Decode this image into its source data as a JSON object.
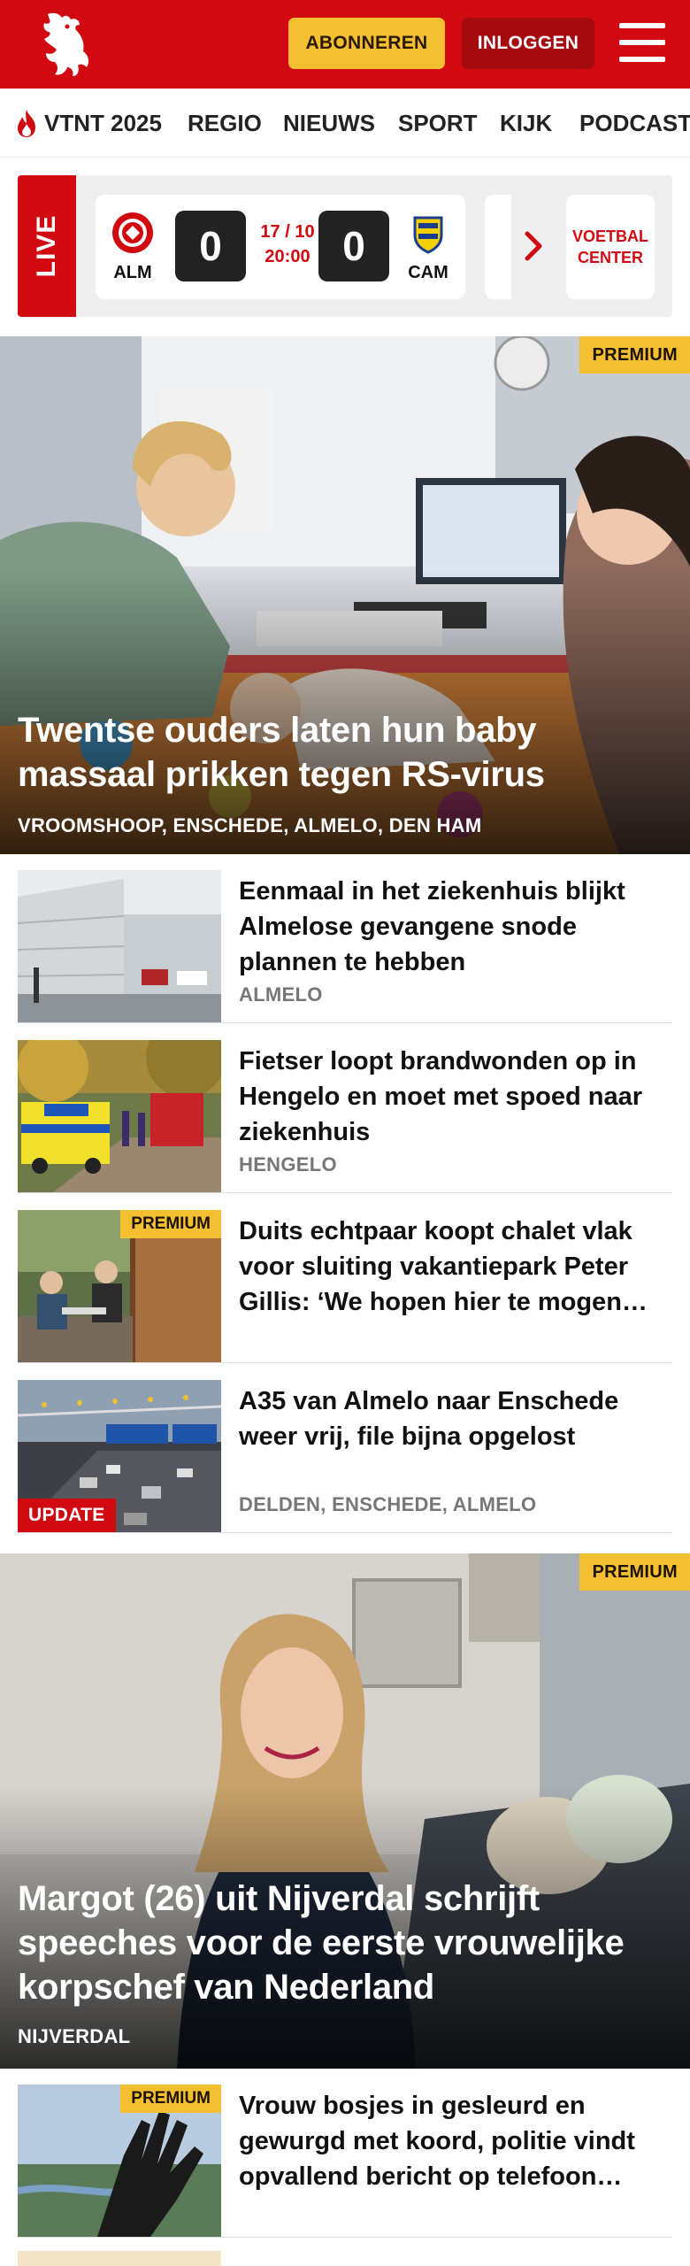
{
  "header": {
    "logo": "horse-logo",
    "subscribe_label": "ABONNEREN",
    "login_label": "INLOGGEN"
  },
  "nav": {
    "items": [
      "VTNT 2025",
      "REGIO",
      "NIEUWS",
      "SPORT",
      "KIJK",
      "PODCAST"
    ]
  },
  "live": {
    "label": "LIVE",
    "match": {
      "home_code": "ALM",
      "away_code": "CAM",
      "home_score": "0",
      "away_score": "0",
      "date": "17 / 10",
      "time": "20:00"
    },
    "voetbal_center_label": "VOETBAL CENTER"
  },
  "hero1": {
    "title": "Twentse ouders laten hun baby massaal prikken tegen RS-virus",
    "location": "VROOMSHOOP, ENSCHEDE, ALMELO, DEN HAM",
    "badge": "PREMIUM"
  },
  "articles": [
    {
      "title": "Eenmaal in het ziekenhuis blijkt Almelose gevangene snode plannen te hebben",
      "location": "ALMELO",
      "badge": ""
    },
    {
      "title": "Fietser loopt brandwonden op in Hengelo en moet met spoed naar ziekenhuis",
      "location": "HENGELO",
      "badge": ""
    },
    {
      "title": "Duits echtpaar koopt chalet vlak voor sluiting vakantiepark Peter Gillis: ‘We hopen hier te mogen…",
      "location": "",
      "badge": "PREMIUM"
    },
    {
      "title": "A35 van Almelo naar Enschede weer vrij, file bijna opgelost",
      "location": "DELDEN, ENSCHEDE, ALMELO",
      "badge": "UPDATE"
    }
  ],
  "hero2": {
    "title": "Margot (26) uit Nijverdal schrijft speeches voor de eerste vrouwelijke korpschef van Nederland",
    "location": "NIJVERDAL",
    "badge": "PREMIUM"
  },
  "articles2": [
    {
      "title": "Vrouw bosjes in gesleurd en gewurgd met koord, politie vindt opvallend bericht op telefoon…",
      "location": "",
      "badge": "PREMIUM"
    }
  ],
  "colors": {
    "brand_red": "#d10a11",
    "premium_yellow": "#f4c031",
    "dark_red": "#a50a0f"
  }
}
